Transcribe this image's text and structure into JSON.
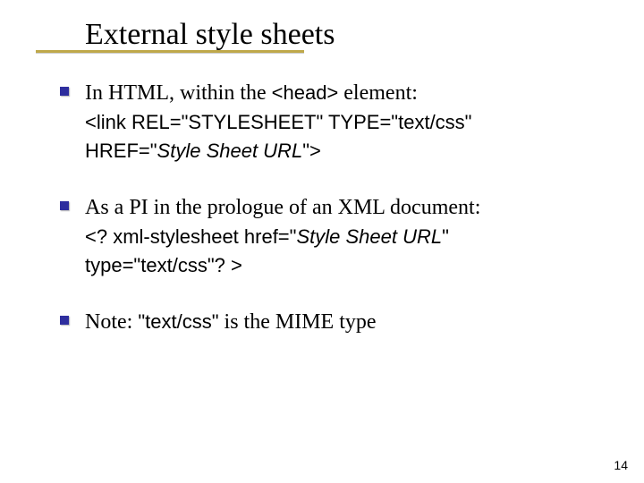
{
  "title": "External style sheets",
  "items": [
    {
      "lead_pre": "In HTML, within the ",
      "lead_code": "<head>",
      "lead_post": " element:",
      "line1_a": "<link REL=\"STYLESHEET\" TYPE=\"text/css\"",
      "line2_a": "HREF=\"",
      "line2_ital": "Style Sheet URL",
      "line2_b": "\">"
    },
    {
      "lead": "As a PI in the prologue of an XML document:",
      "line1_a": "<? xml-stylesheet href=\"",
      "line1_ital": "Style Sheet URL",
      "line1_b": "\"",
      "line2": "type=\"text/css\"? >"
    },
    {
      "lead_pre": "Note: ",
      "mime": "\"text/css\"",
      "lead_post": " is the MIME type"
    }
  ],
  "page_number": "14"
}
